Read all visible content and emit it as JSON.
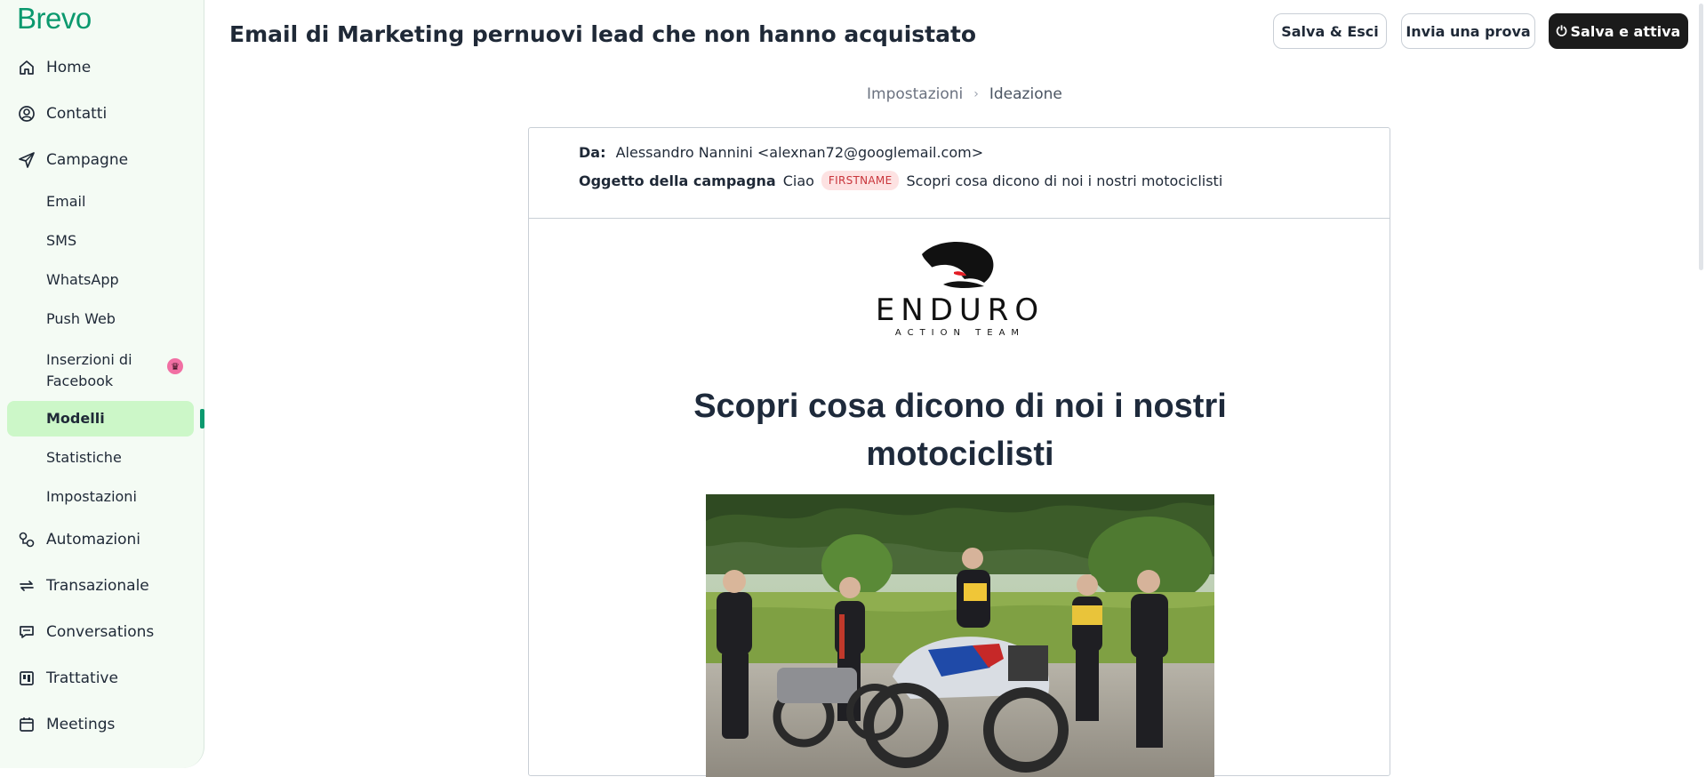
{
  "brand": {
    "logo_text": "Brevo",
    "accent": "#0b996e"
  },
  "sidebar": {
    "items": [
      {
        "label": "Home",
        "icon": "home-icon"
      },
      {
        "label": "Contatti",
        "icon": "contacts-icon"
      },
      {
        "label": "Campagne",
        "icon": "send-icon"
      },
      {
        "label": "Automazioni",
        "icon": "automation-icon"
      },
      {
        "label": "Transazionale",
        "icon": "transactional-icon"
      },
      {
        "label": "Conversations",
        "icon": "chat-icon"
      },
      {
        "label": "Trattative",
        "icon": "deals-icon"
      },
      {
        "label": "Meetings",
        "icon": "calendar-icon"
      }
    ],
    "sub_items": [
      "Email",
      "SMS",
      "WhatsApp",
      "Push Web",
      "Inserzioni di Facebook",
      "Modelli",
      "Statistiche",
      "Impostazioni"
    ],
    "active_sub": "Modelli",
    "badge_icon": "crown-icon"
  },
  "header": {
    "title": "Email di Marketing pernuovi lead che non hanno acquistato",
    "buttons": {
      "save_exit": "Salva & Esci",
      "send_test": "Invia una prova",
      "save_activate": "Salva e attiva"
    }
  },
  "breadcrumb": {
    "step1": "Impostazioni",
    "step2": "Ideazione"
  },
  "preview": {
    "from_label": "Da:",
    "from_value": "Alessandro Nannini <alexnan72@googlemail.com>",
    "subject_label": "Oggetto della campagna",
    "subject_greeting": "Ciao",
    "subject_tag": "FIRSTNAME",
    "subject_text": "Scopri cosa dicono di noi i nostri motociclisti",
    "logo_main": "ENDURO",
    "logo_sub": "ACTION TEAM",
    "headline": "Scopri cosa dicono di noi i nostri motociclisti"
  }
}
